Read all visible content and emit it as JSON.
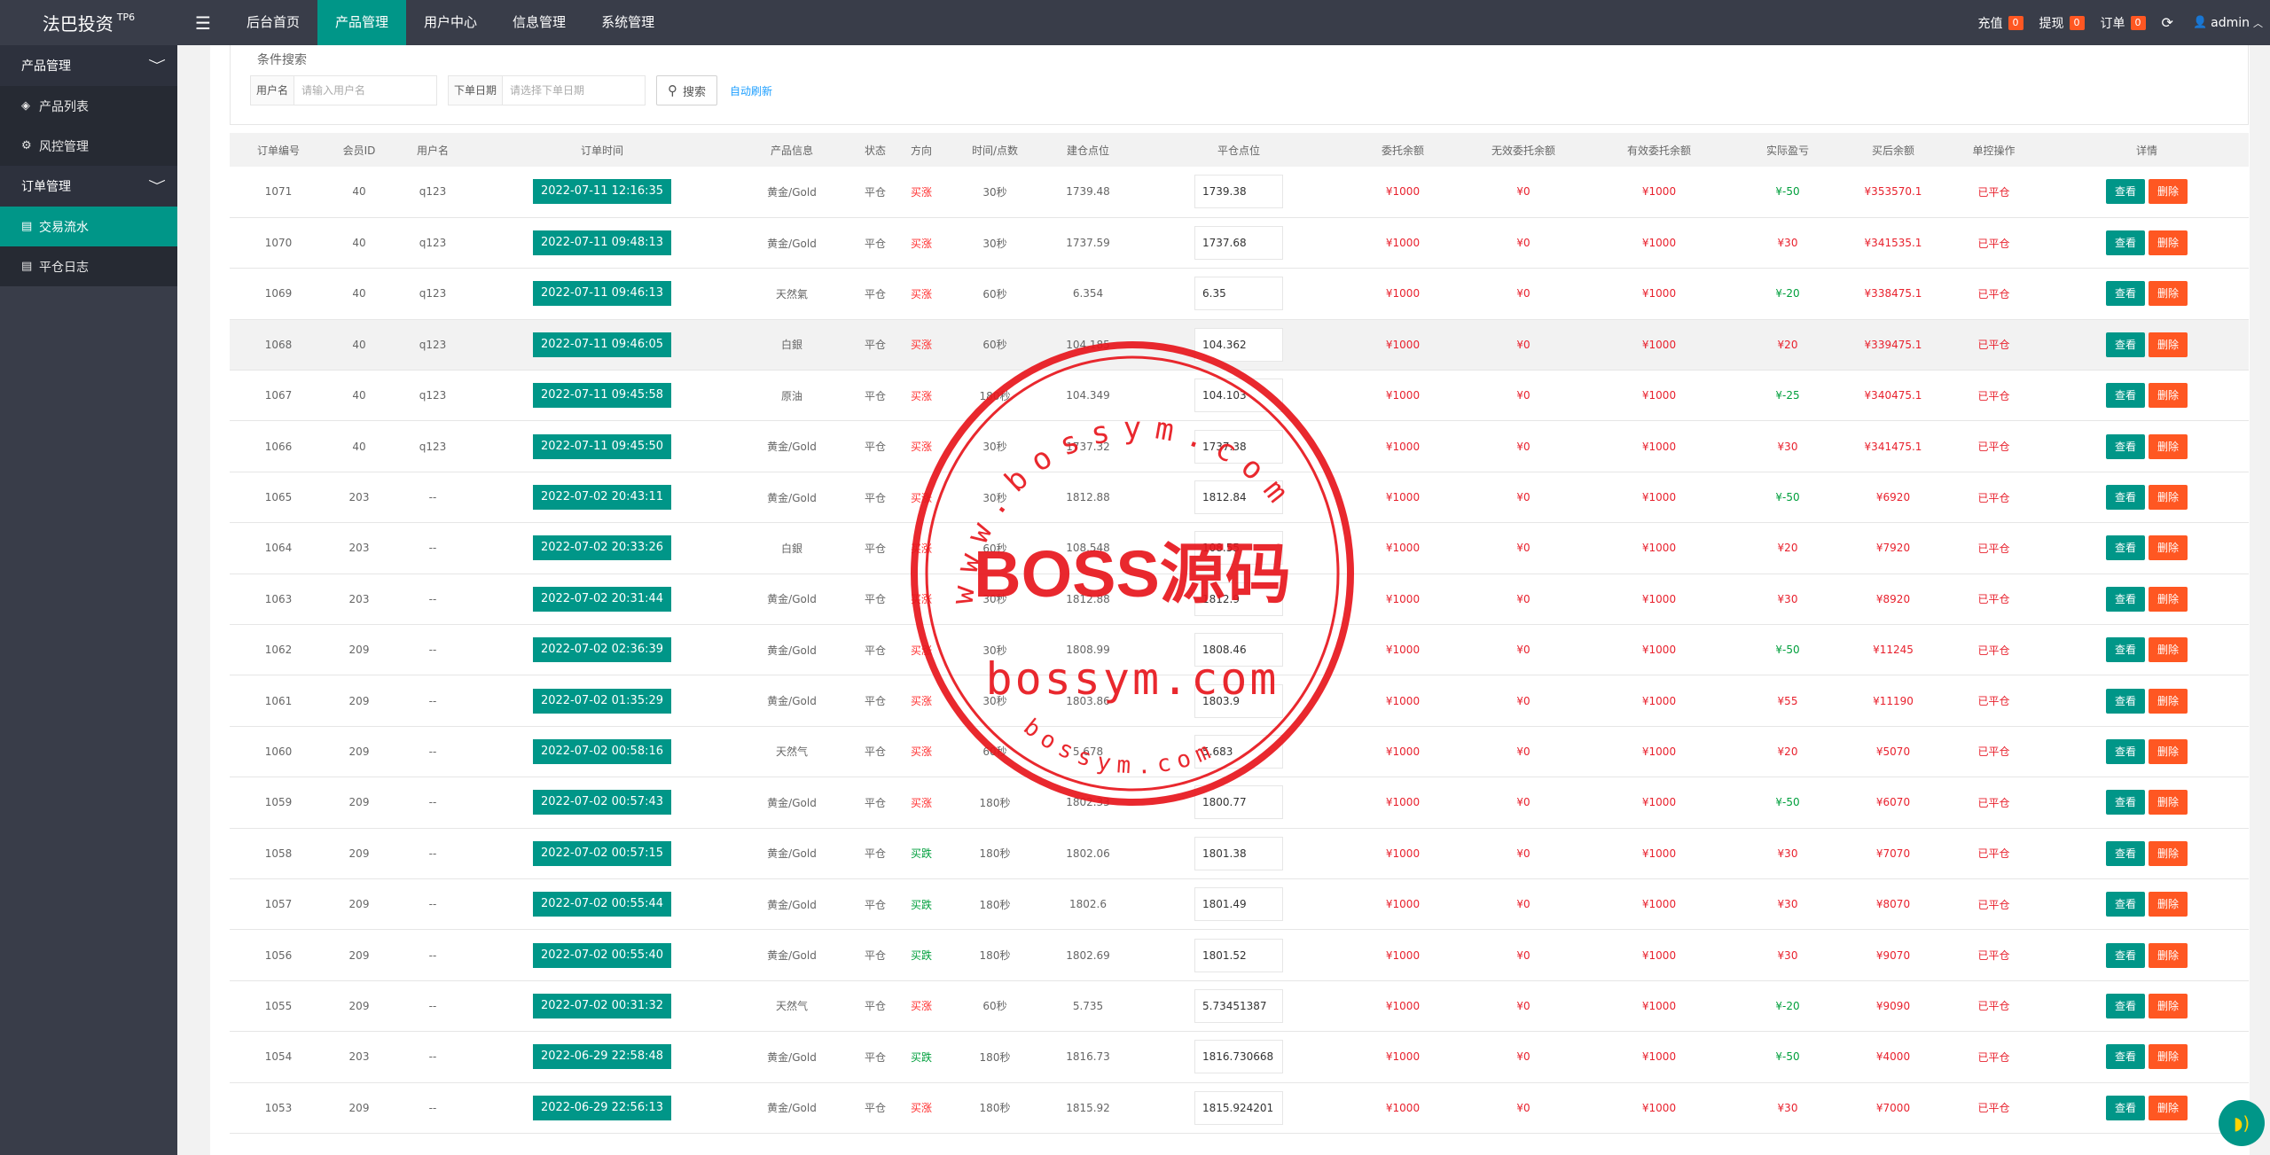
{
  "app": {
    "logo": "法巴投资",
    "logo_sup": "TP6",
    "menu_icon": "hamburger-icon"
  },
  "nav": [
    {
      "label": "后台首页"
    },
    {
      "label": "产品管理"
    },
    {
      "label": "用户中心"
    },
    {
      "label": "信息管理"
    },
    {
      "label": "系统管理"
    }
  ],
  "topright": {
    "recharge_label": "充值",
    "recharge_count": "0",
    "withdraw_label": "提现",
    "withdraw_count": "0",
    "order_label": "订单",
    "order_count": "0",
    "user": "admin"
  },
  "sidebar": {
    "group1": "产品管理",
    "item1": "产品列表",
    "item2": "风控管理",
    "group2": "订单管理",
    "item3": "交易流水",
    "item4": "平仓日志"
  },
  "search": {
    "title": "条件搜索",
    "username_label": "用户名",
    "username_placeholder": "请输入用户名",
    "date_label": "下单日期",
    "date_placeholder": "请选择下单日期",
    "search_button": "搜索",
    "auto_refresh": "自动刷新"
  },
  "table": {
    "headers": [
      "订单编号",
      "会员ID",
      "用户名",
      "订单时间",
      "产品信息",
      "状态",
      "方向",
      "时间/点数",
      "建仓点位",
      "平仓点位",
      "委托余额",
      "无效委托余额",
      "有效委托余额",
      "实际盈亏",
      "买后余额",
      "单控操作",
      "详情"
    ],
    "view_label": "查看",
    "delete_label": "删除",
    "rows": [
      {
        "id": "1071",
        "mid": "40",
        "user": "q123",
        "time": "2022-07-11 12:16:35",
        "product": "黄金/Gold",
        "status": "平仓",
        "dir": "买涨",
        "period": "30秒",
        "open": "1739.48",
        "close": "1739.38",
        "entrust": "¥1000",
        "invalid": "¥0",
        "valid": "¥1000",
        "pnl": "¥-50",
        "balance": "¥353570.1",
        "ctrl": "已平仓"
      },
      {
        "id": "1070",
        "mid": "40",
        "user": "q123",
        "time": "2022-07-11 09:48:13",
        "product": "黄金/Gold",
        "status": "平仓",
        "dir": "买涨",
        "period": "30秒",
        "open": "1737.59",
        "close": "1737.68",
        "entrust": "¥1000",
        "invalid": "¥0",
        "valid": "¥1000",
        "pnl": "¥30",
        "balance": "¥341535.1",
        "ctrl": "已平仓"
      },
      {
        "id": "1069",
        "mid": "40",
        "user": "q123",
        "time": "2022-07-11 09:46:13",
        "product": "天然氣",
        "status": "平仓",
        "dir": "买涨",
        "period": "60秒",
        "open": "6.354",
        "close": "6.35",
        "entrust": "¥1000",
        "invalid": "¥0",
        "valid": "¥1000",
        "pnl": "¥-20",
        "balance": "¥338475.1",
        "ctrl": "已平仓"
      },
      {
        "id": "1068",
        "mid": "40",
        "user": "q123",
        "time": "2022-07-11 09:46:05",
        "product": "白銀",
        "status": "平仓",
        "dir": "买涨",
        "period": "60秒",
        "open": "104.185",
        "close": "104.362",
        "entrust": "¥1000",
        "invalid": "¥0",
        "valid": "¥1000",
        "pnl": "¥20",
        "balance": "¥339475.1",
        "ctrl": "已平仓"
      },
      {
        "id": "1067",
        "mid": "40",
        "user": "q123",
        "time": "2022-07-11 09:45:58",
        "product": "原油",
        "status": "平仓",
        "dir": "买涨",
        "period": "180秒",
        "open": "104.349",
        "close": "104.103",
        "entrust": "¥1000",
        "invalid": "¥0",
        "valid": "¥1000",
        "pnl": "¥-25",
        "balance": "¥340475.1",
        "ctrl": "已平仓"
      },
      {
        "id": "1066",
        "mid": "40",
        "user": "q123",
        "time": "2022-07-11 09:45:50",
        "product": "黄金/Gold",
        "status": "平仓",
        "dir": "买涨",
        "period": "30秒",
        "open": "1737.32",
        "close": "1737.38",
        "entrust": "¥1000",
        "invalid": "¥0",
        "valid": "¥1000",
        "pnl": "¥30",
        "balance": "¥341475.1",
        "ctrl": "已平仓"
      },
      {
        "id": "1065",
        "mid": "203",
        "user": "--",
        "time": "2022-07-02 20:43:11",
        "product": "黄金/Gold",
        "status": "平仓",
        "dir": "买涨",
        "period": "30秒",
        "open": "1812.88",
        "close": "1812.84",
        "entrust": "¥1000",
        "invalid": "¥0",
        "valid": "¥1000",
        "pnl": "¥-50",
        "balance": "¥6920",
        "ctrl": "已平仓"
      },
      {
        "id": "1064",
        "mid": "203",
        "user": "--",
        "time": "2022-07-02 20:33:26",
        "product": "白銀",
        "status": "平仓",
        "dir": "买涨",
        "period": "60秒",
        "open": "108.548",
        "close": "108.55",
        "entrust": "¥1000",
        "invalid": "¥0",
        "valid": "¥1000",
        "pnl": "¥20",
        "balance": "¥7920",
        "ctrl": "已平仓"
      },
      {
        "id": "1063",
        "mid": "203",
        "user": "--",
        "time": "2022-07-02 20:31:44",
        "product": "黄金/Gold",
        "status": "平仓",
        "dir": "买涨",
        "period": "30秒",
        "open": "1812.88",
        "close": "1812.9",
        "entrust": "¥1000",
        "invalid": "¥0",
        "valid": "¥1000",
        "pnl": "¥30",
        "balance": "¥8920",
        "ctrl": "已平仓"
      },
      {
        "id": "1062",
        "mid": "209",
        "user": "--",
        "time": "2022-07-02 02:36:39",
        "product": "黄金/Gold",
        "status": "平仓",
        "dir": "买涨",
        "period": "30秒",
        "open": "1808.99",
        "close": "1808.46",
        "entrust": "¥1000",
        "invalid": "¥0",
        "valid": "¥1000",
        "pnl": "¥-50",
        "balance": "¥11245",
        "ctrl": "已平仓"
      },
      {
        "id": "1061",
        "mid": "209",
        "user": "--",
        "time": "2022-07-02 01:35:29",
        "product": "黄金/Gold",
        "status": "平仓",
        "dir": "买涨",
        "period": "30秒",
        "open": "1803.86",
        "close": "1803.9",
        "entrust": "¥1000",
        "invalid": "¥0",
        "valid": "¥1000",
        "pnl": "¥55",
        "balance": "¥11190",
        "ctrl": "已平仓"
      },
      {
        "id": "1060",
        "mid": "209",
        "user": "--",
        "time": "2022-07-02 00:58:16",
        "product": "天然气",
        "status": "平仓",
        "dir": "买涨",
        "period": "60秒",
        "open": "5.678",
        "close": "5.683",
        "entrust": "¥1000",
        "invalid": "¥0",
        "valid": "¥1000",
        "pnl": "¥20",
        "balance": "¥5070",
        "ctrl": "已平仓"
      },
      {
        "id": "1059",
        "mid": "209",
        "user": "--",
        "time": "2022-07-02 00:57:43",
        "product": "黄金/Gold",
        "status": "平仓",
        "dir": "买涨",
        "period": "180秒",
        "open": "1802.33",
        "close": "1800.77",
        "entrust": "¥1000",
        "invalid": "¥0",
        "valid": "¥1000",
        "pnl": "¥-50",
        "balance": "¥6070",
        "ctrl": "已平仓"
      },
      {
        "id": "1058",
        "mid": "209",
        "user": "--",
        "time": "2022-07-02 00:57:15",
        "product": "黄金/Gold",
        "status": "平仓",
        "dir": "买跌",
        "period": "180秒",
        "open": "1802.06",
        "close": "1801.38",
        "entrust": "¥1000",
        "invalid": "¥0",
        "valid": "¥1000",
        "pnl": "¥30",
        "balance": "¥7070",
        "ctrl": "已平仓"
      },
      {
        "id": "1057",
        "mid": "209",
        "user": "--",
        "time": "2022-07-02 00:55:44",
        "product": "黄金/Gold",
        "status": "平仓",
        "dir": "买跌",
        "period": "180秒",
        "open": "1802.6",
        "close": "1801.49",
        "entrust": "¥1000",
        "invalid": "¥0",
        "valid": "¥1000",
        "pnl": "¥30",
        "balance": "¥8070",
        "ctrl": "已平仓"
      },
      {
        "id": "1056",
        "mid": "209",
        "user": "--",
        "time": "2022-07-02 00:55:40",
        "product": "黄金/Gold",
        "status": "平仓",
        "dir": "买跌",
        "period": "180秒",
        "open": "1802.69",
        "close": "1801.52",
        "entrust": "¥1000",
        "invalid": "¥0",
        "valid": "¥1000",
        "pnl": "¥30",
        "balance": "¥9070",
        "ctrl": "已平仓"
      },
      {
        "id": "1055",
        "mid": "209",
        "user": "--",
        "time": "2022-07-02 00:31:32",
        "product": "天然气",
        "status": "平仓",
        "dir": "买涨",
        "period": "60秒",
        "open": "5.735",
        "close": "5.73451387",
        "entrust": "¥1000",
        "invalid": "¥0",
        "valid": "¥1000",
        "pnl": "¥-20",
        "balance": "¥9090",
        "ctrl": "已平仓"
      },
      {
        "id": "1054",
        "mid": "203",
        "user": "--",
        "time": "2022-06-29 22:58:48",
        "product": "黄金/Gold",
        "status": "平仓",
        "dir": "买跌",
        "period": "180秒",
        "open": "1816.73",
        "close": "1816.730668",
        "entrust": "¥1000",
        "invalid": "¥0",
        "valid": "¥1000",
        "pnl": "¥-50",
        "balance": "¥4000",
        "ctrl": "已平仓"
      },
      {
        "id": "1053",
        "mid": "209",
        "user": "--",
        "time": "2022-06-29 22:56:13",
        "product": "黄金/Gold",
        "status": "平仓",
        "dir": "买涨",
        "period": "180秒",
        "open": "1815.92",
        "close": "1815.924201",
        "entrust": "¥1000",
        "invalid": "¥0",
        "valid": "¥1000",
        "pnl": "¥30",
        "balance": "¥7000",
        "ctrl": "已平仓"
      }
    ]
  },
  "watermark": {
    "center": "BOSS源码",
    "line2": "bossym.com",
    "arc_top": "www.bossym.com",
    "arc_bottom": "bossym.com"
  },
  "fab_icon": "chat-icon"
}
